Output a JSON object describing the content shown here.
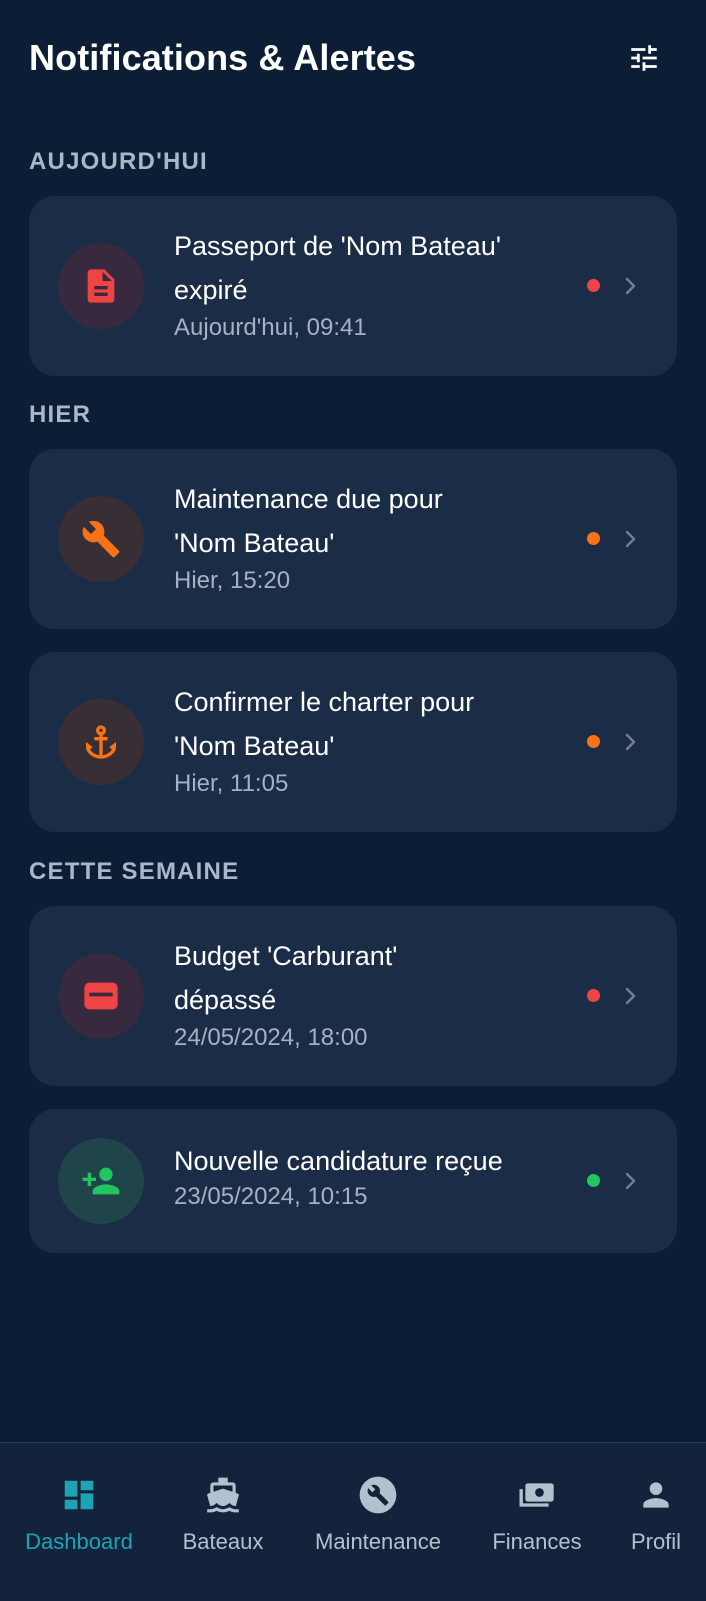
{
  "header": {
    "title": "Notifications & Alertes",
    "filter_icon": "sliders-icon"
  },
  "sections": [
    {
      "label": "AUJOURD'HUI"
    },
    {
      "label": "HIER"
    },
    {
      "label": "CETTE SEMAINE"
    }
  ],
  "notifications": [
    {
      "icon": "document-icon",
      "title_line1": "Passeport de 'Nom Bateau'",
      "title_line2": "expiré",
      "time": "Aujourd'hui, 09:41",
      "status_color": "#ef4444",
      "icon_color": "#ef4444"
    },
    {
      "icon": "wrench-icon",
      "title_line1": "Maintenance due pour",
      "title_line2": "'Nom Bateau'",
      "time": "Hier, 15:20",
      "status_color": "#f97316",
      "icon_color": "#f97316"
    },
    {
      "icon": "anchor-icon",
      "title_line1": "Confirmer le charter pour",
      "title_line2": "'Nom Bateau'",
      "time": "Hier, 11:05",
      "status_color": "#f97316",
      "icon_color": "#f97316"
    },
    {
      "icon": "wallet-icon",
      "title_line1": "Budget 'Carburant'",
      "title_line2": "dépassé",
      "time": "24/05/2024, 18:00",
      "status_color": "#ef4444",
      "icon_color": "#ef4444"
    },
    {
      "icon": "person-add-icon",
      "title_line1": "Nouvelle candidature reçue",
      "title_line2": "",
      "time": "23/05/2024, 10:15",
      "status_color": "#22c55e",
      "icon_color": "#22c55e"
    }
  ],
  "nav": {
    "active_color": "#1ea3b6",
    "inactive_color": "#b3c1cf",
    "items": [
      {
        "label": "Dashboard",
        "icon": "dashboard-icon",
        "active": true
      },
      {
        "label": "Bateaux",
        "icon": "boat-icon",
        "active": false
      },
      {
        "label": "Maintenance",
        "icon": "maintenance-icon",
        "active": false
      },
      {
        "label": "Finances",
        "icon": "money-icon",
        "active": false
      },
      {
        "label": "Profil",
        "icon": "person-icon",
        "active": false
      }
    ]
  }
}
